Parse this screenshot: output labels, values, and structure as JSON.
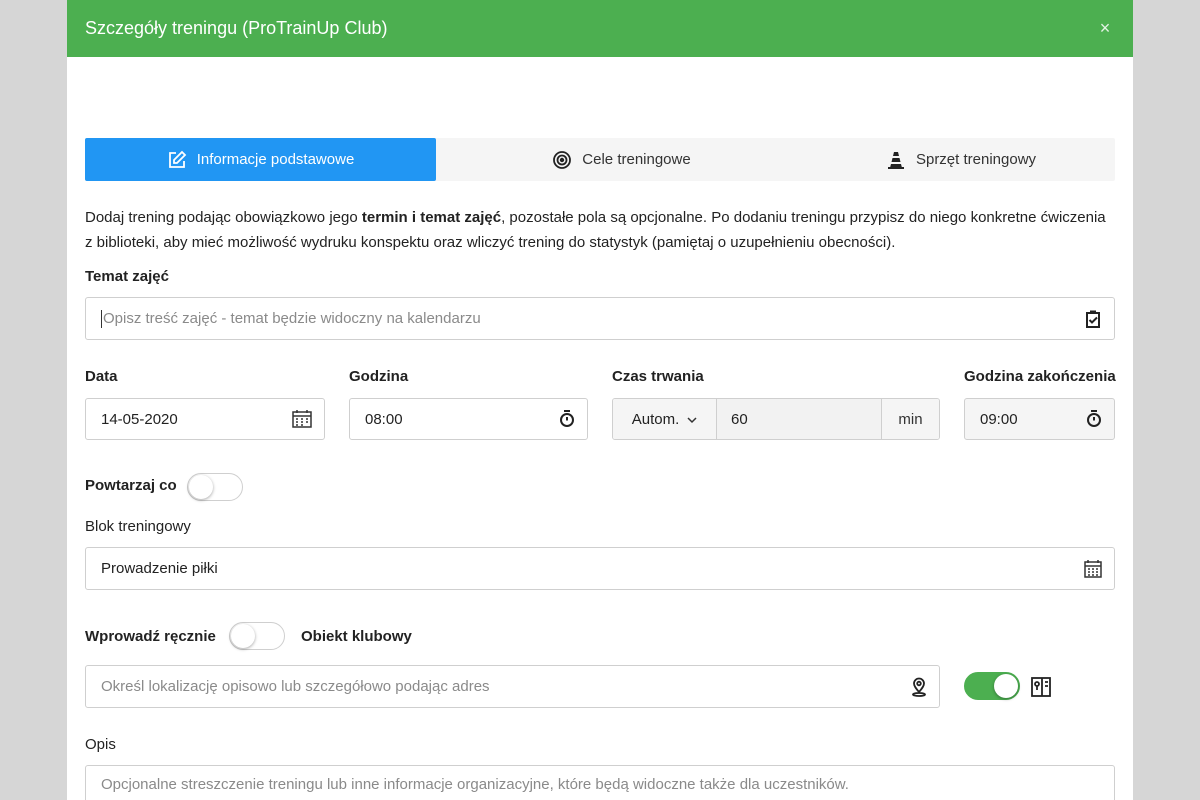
{
  "header": {
    "title": "Szczegóły treningu (ProTrainUp Club)",
    "close_label": "×"
  },
  "tabs": [
    {
      "label": "Informacje podstawowe",
      "icon": "edit-icon",
      "active": true
    },
    {
      "label": "Cele treningowe",
      "icon": "target-icon",
      "active": false
    },
    {
      "label": "Sprzęt treningowy",
      "icon": "cone-icon",
      "active": false
    }
  ],
  "intro": {
    "part1": "Dodaj trening podając obowiązkowo jego ",
    "bold": "termin i temat zajęć",
    "part2": ", pozostałe pola są opcjonalne. Po dodaniu treningu przypisz do niego konkretne ćwiczenia z biblioteki, aby mieć możliwość wydruku konspektu oraz wliczyć trening do statystyk (pamiętaj o uzupełnieniu obecności)."
  },
  "topic": {
    "label": "Temat zajęć",
    "placeholder": "Opisz treść zajęć - temat będzie widoczny na kalendarzu",
    "value": ""
  },
  "date": {
    "label": "Data",
    "value": "14-05-2020"
  },
  "time": {
    "label": "Godzina",
    "value": "08:00"
  },
  "duration": {
    "label": "Czas trwania",
    "mode": "Autom.",
    "value": "60",
    "unit": "min"
  },
  "end_time": {
    "label": "Godzina zakończenia",
    "value": "09:00"
  },
  "repeat": {
    "label": "Powtarzaj co",
    "enabled": false
  },
  "block": {
    "label": "Blok treningowy",
    "value": "Prowadzenie piłki"
  },
  "location": {
    "manual_label": "Wprowadź ręcznie",
    "manual_enabled": false,
    "club_label": "Obiekt klubowy",
    "placeholder": "Określ lokalizację opisowo lub szczegółowo podając adres",
    "club_enabled": true
  },
  "description": {
    "label": "Opis",
    "placeholder": "Opcjonalne streszczenie treningu lub inne informacje organizacyjne, które będą widoczne także dla uczestników."
  },
  "colors": {
    "header": "#4caf50",
    "active_tab": "#2196f3",
    "toggle_on": "#4caf50"
  }
}
